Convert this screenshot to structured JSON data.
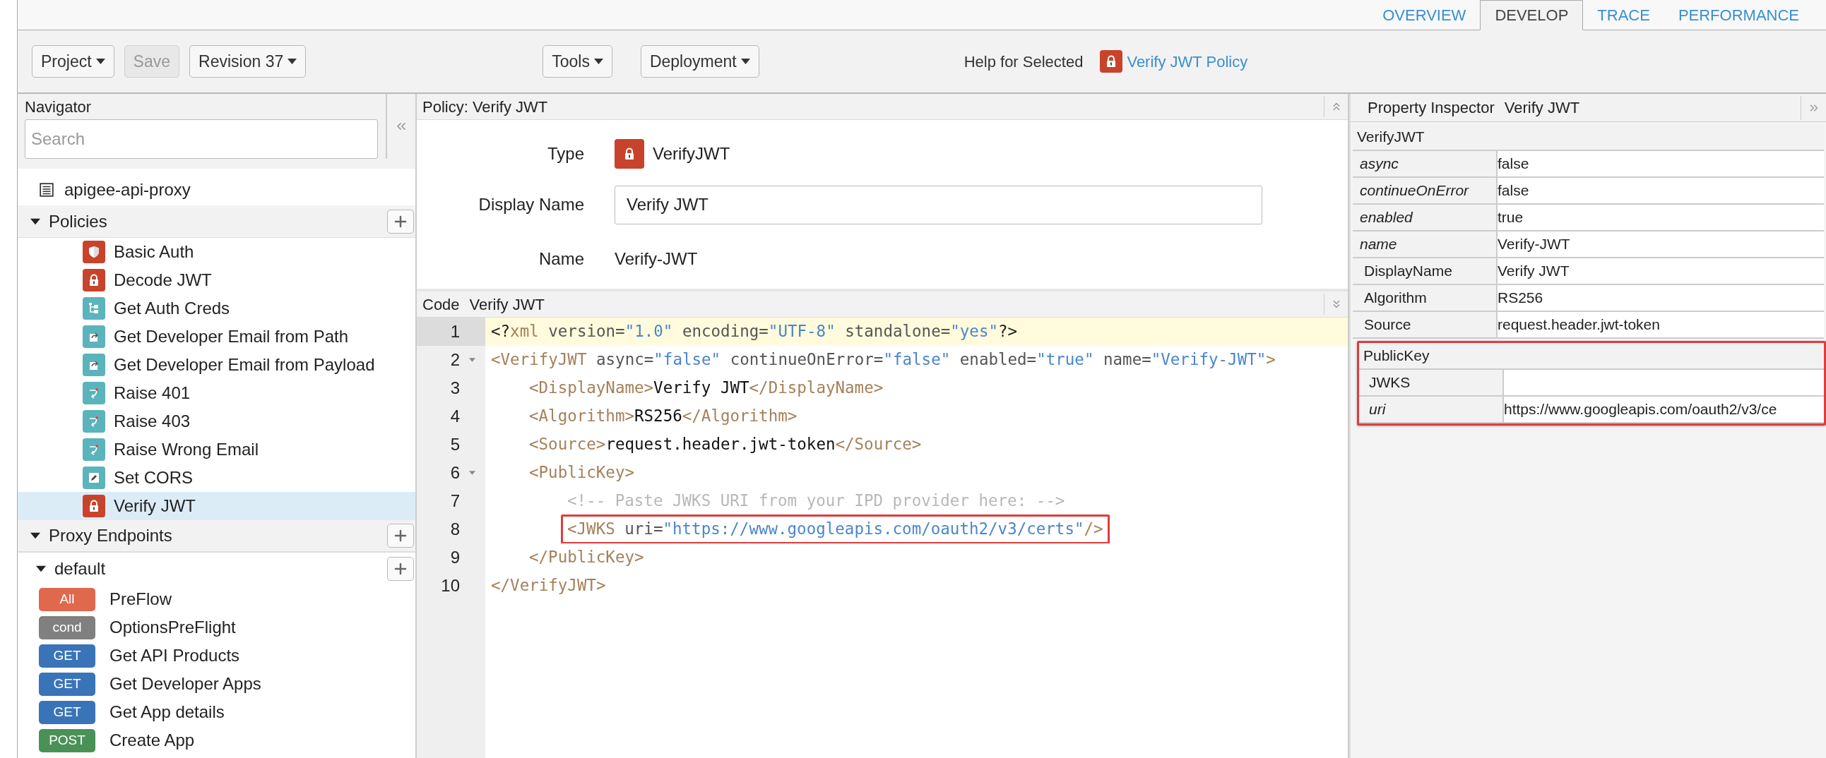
{
  "tabs": [
    {
      "label": "OVERVIEW",
      "selected": false
    },
    {
      "label": "DEVELOP",
      "selected": true
    },
    {
      "label": "TRACE",
      "selected": false
    },
    {
      "label": "PERFORMANCE",
      "selected": false
    }
  ],
  "toolbar": {
    "left": [
      {
        "label": "Project",
        "menu": true,
        "disabled": false
      },
      {
        "label": "Save",
        "menu": false,
        "disabled": true
      },
      {
        "label": "Revision 37",
        "menu": true,
        "disabled": false
      }
    ],
    "middle": [
      {
        "label": "Tools",
        "menu": true,
        "disabled": false
      },
      {
        "label": "Deployment",
        "menu": true,
        "disabled": false
      }
    ],
    "help": {
      "label": "Help for Selected",
      "link": "Verify JWT Policy",
      "kind": "lock"
    }
  },
  "navigator": {
    "title": "Navigator",
    "search": {
      "placeholder": "Search"
    },
    "proxy": "apigee-api-proxy",
    "policies": {
      "title": "Policies",
      "expanded": true,
      "items": [
        {
          "name": "Basic Auth",
          "kind": "shield",
          "selected": false
        },
        {
          "name": "Decode JWT",
          "kind": "lock",
          "selected": false
        },
        {
          "name": "Get Auth Creds",
          "kind": "tree",
          "selected": false
        },
        {
          "name": "Get Developer Email from Path",
          "kind": "extract",
          "selected": false
        },
        {
          "name": "Get Developer Email from Payload",
          "kind": "extract",
          "selected": false
        },
        {
          "name": "Raise 401",
          "kind": "raise",
          "selected": false
        },
        {
          "name": "Raise 403",
          "kind": "raise",
          "selected": false
        },
        {
          "name": "Raise Wrong Email",
          "kind": "raise",
          "selected": false
        },
        {
          "name": "Set CORS",
          "kind": "edit",
          "selected": false
        },
        {
          "name": "Verify JWT",
          "kind": "lock",
          "selected": true
        }
      ]
    },
    "proxy_endpoints": {
      "title": "Proxy Endpoints",
      "expanded": true,
      "children": [
        {
          "name": "default",
          "expanded": true,
          "flows": [
            {
              "method": "All",
              "color": "#e0694d",
              "name": "PreFlow",
              "selected": false
            },
            {
              "method": "cond",
              "color": "#808080",
              "name": "OptionsPreFlight",
              "selected": false
            },
            {
              "method": "GET",
              "color": "#3a74b8",
              "name": "Get API Products",
              "selected": false
            },
            {
              "method": "GET",
              "color": "#3a74b8",
              "name": "Get Developer Apps",
              "selected": false
            },
            {
              "method": "GET",
              "color": "#3a74b8",
              "name": "Get App details",
              "selected": false
            },
            {
              "method": "POST",
              "color": "#4a9157",
              "name": "Create App",
              "selected": false
            }
          ]
        }
      ]
    }
  },
  "policy_panel": {
    "title": "Policy: Verify JWT",
    "type_label": "Type",
    "type": "VerifyJWT",
    "kind": "lock",
    "display_name_label": "Display Name",
    "display_name": "Verify JWT",
    "name_label": "Name",
    "name": "Verify-JWT"
  },
  "code": {
    "title": "Code",
    "subtitle": "Verify JWT",
    "lines": [
      {
        "number": "1",
        "foldable": false,
        "active": true,
        "boxed": false,
        "tokens": [
          {
            "kind": "punct",
            "text": "<?"
          },
          {
            "kind": "tag",
            "text": "xml"
          },
          {
            "kind": "attr",
            "text": " version="
          },
          {
            "kind": "value",
            "text": "\"1.0\""
          },
          {
            "kind": "attr",
            "text": " encoding="
          },
          {
            "kind": "value",
            "text": "\"UTF-8\""
          },
          {
            "kind": "attr",
            "text": " standalone="
          },
          {
            "kind": "value",
            "text": "\"yes\""
          },
          {
            "kind": "punct",
            "text": "?>"
          }
        ]
      },
      {
        "number": "2",
        "foldable": true,
        "active": false,
        "boxed": false,
        "tokens": [
          {
            "kind": "tag",
            "text": "<VerifyJWT"
          },
          {
            "kind": "attr",
            "text": " async="
          },
          {
            "kind": "value",
            "text": "\"false\""
          },
          {
            "kind": "attr",
            "text": " continueOnError="
          },
          {
            "kind": "value",
            "text": "\"false\""
          },
          {
            "kind": "attr",
            "text": " enabled="
          },
          {
            "kind": "value",
            "text": "\"true\""
          },
          {
            "kind": "attr",
            "text": " name="
          },
          {
            "kind": "value",
            "text": "\"Verify-JWT\""
          },
          {
            "kind": "tag",
            "text": ">"
          }
        ],
        "children": [
          {
            "number": "3",
            "foldable": false,
            "active": false,
            "boxed": false,
            "tokens": [
              {
                "kind": "tag",
                "text": "<DisplayName>"
              },
              {
                "kind": "text",
                "text": "Verify JWT"
              },
              {
                "kind": "tag",
                "text": "</DisplayName>"
              }
            ]
          },
          {
            "number": "4",
            "foldable": false,
            "active": false,
            "boxed": false,
            "tokens": [
              {
                "kind": "tag",
                "text": "<Algorithm>"
              },
              {
                "kind": "text",
                "text": "RS256"
              },
              {
                "kind": "tag",
                "text": "</Algorithm>"
              }
            ]
          },
          {
            "number": "5",
            "foldable": false,
            "active": false,
            "boxed": false,
            "tokens": [
              {
                "kind": "tag",
                "text": "<Source>"
              },
              {
                "kind": "text",
                "text": "request.header.jwt-token"
              },
              {
                "kind": "tag",
                "text": "</Source>"
              }
            ]
          },
          {
            "number": "6",
            "foldable": true,
            "active": false,
            "boxed": false,
            "tokens": [
              {
                "kind": "tag",
                "text": "<PublicKey>"
              }
            ],
            "children": [
              {
                "number": "7",
                "foldable": false,
                "active": false,
                "boxed": false,
                "tokens": [
                  {
                    "kind": "comment",
                    "text": "<!-- Paste JWKS URI from your IPD provider here: -->"
                  }
                ]
              },
              {
                "number": "8",
                "foldable": false,
                "active": false,
                "boxed": true,
                "tokens": [
                  {
                    "kind": "tag",
                    "text": "<JWKS"
                  },
                  {
                    "kind": "attr",
                    "text": " uri="
                  },
                  {
                    "kind": "value",
                    "text": "\"https://www.googleapis.com/oauth2/v3/certs\""
                  },
                  {
                    "kind": "tag",
                    "text": "/>"
                  }
                ]
              }
            ]
          },
          {
            "number": "9",
            "foldable": false,
            "active": false,
            "boxed": false,
            "tokens": [
              {
                "kind": "tag",
                "text": "</PublicKey>"
              }
            ]
          }
        ]
      },
      {
        "number": "10",
        "foldable": false,
        "active": false,
        "boxed": false,
        "tokens": [
          {
            "kind": "tag",
            "text": "</VerifyJWT>"
          }
        ]
      }
    ]
  },
  "inspector": {
    "title": "Property Inspector",
    "subtitle": "Verify JWT",
    "sections": [
      {
        "title": "VerifyJWT",
        "highlighted": false,
        "rows": [
          {
            "kind": "attribute",
            "label": "async",
            "value": "false"
          },
          {
            "kind": "attribute",
            "label": "continueOnError",
            "value": "false"
          },
          {
            "kind": "attribute",
            "label": "enabled",
            "value": "true"
          },
          {
            "kind": "attribute",
            "label": "name",
            "value": "Verify-JWT"
          },
          {
            "kind": "element",
            "label": "DisplayName",
            "value": "Verify JWT"
          },
          {
            "kind": "element",
            "label": "Algorithm",
            "value": "RS256"
          },
          {
            "kind": "element",
            "label": "Source",
            "value": "request.header.jwt-token"
          }
        ]
      },
      {
        "title": "PublicKey",
        "highlighted": true,
        "rows": [
          {
            "kind": "element",
            "label": "JWKS"
          },
          {
            "kind": "attribute",
            "label": "uri",
            "value": "https://www.googleapis.com/oauth2/v3/ce"
          }
        ]
      }
    ]
  }
}
